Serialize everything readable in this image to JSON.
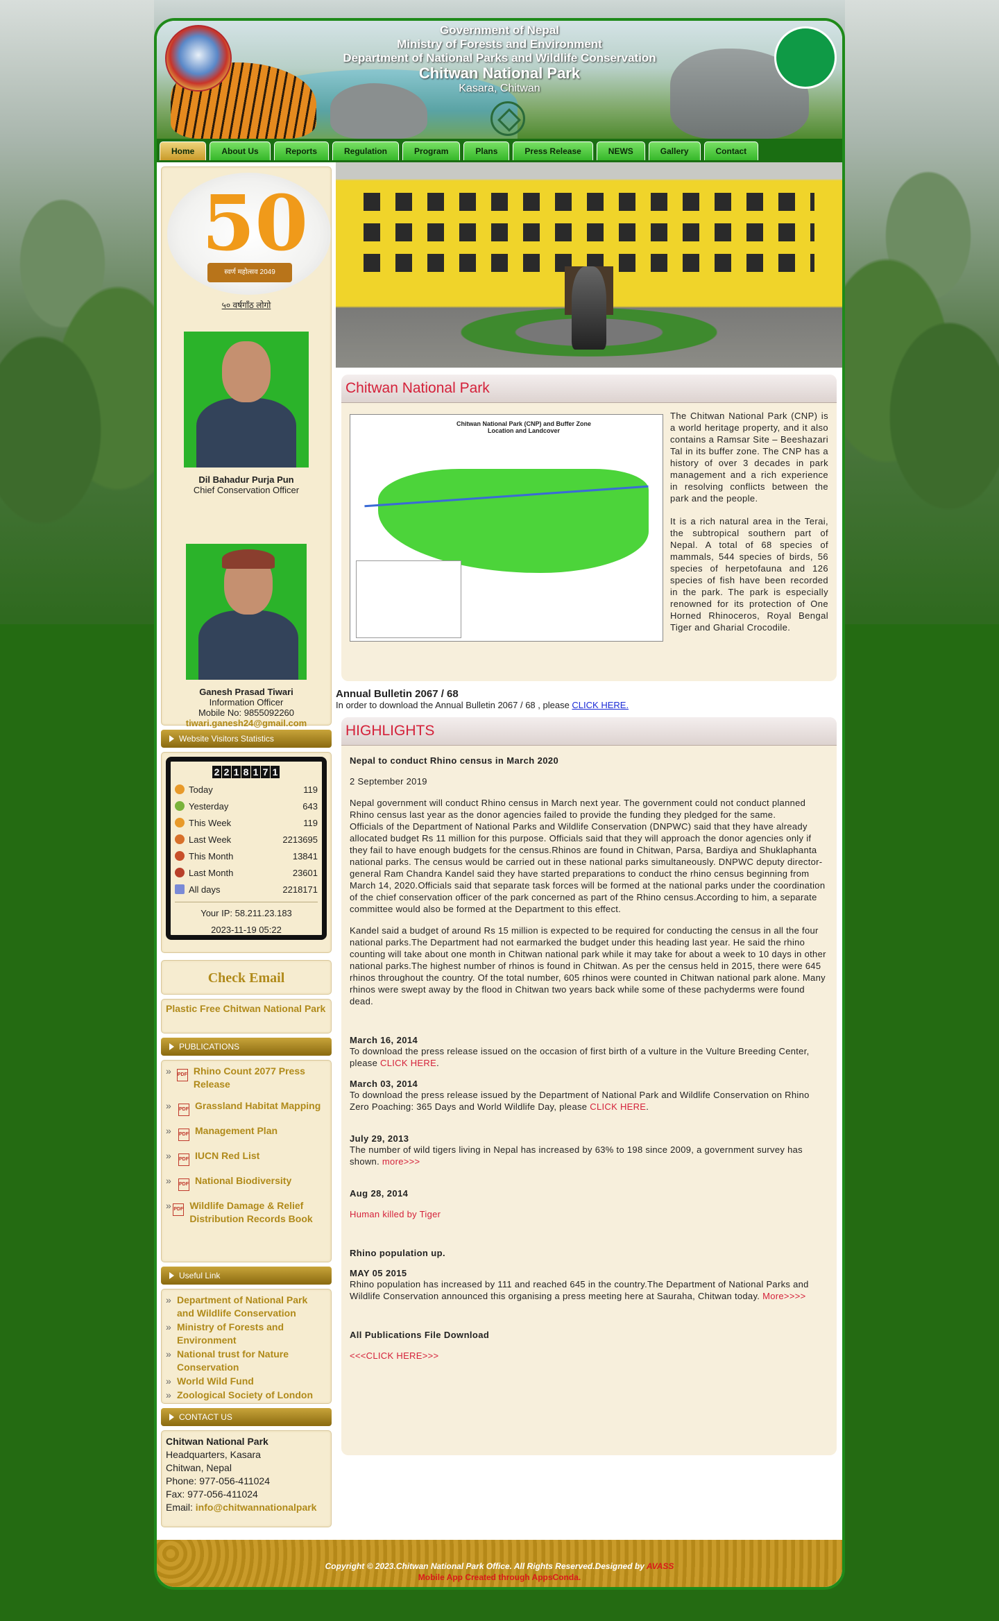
{
  "header": {
    "line1": "Government of Nepal",
    "line2": "Ministry of Forests and Environment",
    "line3": "Department of National Parks and Wildlife Conservation",
    "title": "Chitwan National Park",
    "location": "Kasara, Chitwan"
  },
  "nav": [
    "Home",
    "About Us",
    "Reports",
    "Regulation",
    "Program",
    "Plans",
    "Press Release",
    "NEWS",
    "Gallery",
    "Contact"
  ],
  "left": {
    "jubilee_link": "५० वर्षगाँठ लोगो",
    "jubilee_ribbon": "स्वर्ण महोत्सव 2049",
    "person1": {
      "name": "Dil Bahadur Purja Pun",
      "title": "Chief Conservation Officer"
    },
    "person2": {
      "name": "Ganesh Prasad Tiwari",
      "title": "Information Officer",
      "mobile": "Mobile No: 9855092260",
      "email": "tiwari.ganesh24@gmail.com"
    },
    "visitors_title": "Website Visitors Statistics",
    "counter": [
      "2",
      "2",
      "1",
      "8",
      "1",
      "7",
      "1"
    ],
    "stats": [
      {
        "label": "Today",
        "value": "119"
      },
      {
        "label": "Yesterday",
        "value": "643"
      },
      {
        "label": "This Week",
        "value": "119"
      },
      {
        "label": "Last Week",
        "value": "2213695"
      },
      {
        "label": "This Month",
        "value": "13841"
      },
      {
        "label": "Last Month",
        "value": "23601"
      },
      {
        "label": "All days",
        "value": "2218171"
      }
    ],
    "ip": "Your IP: 58.211.23.183",
    "datetime": "2023-11-19 05:22",
    "check_email": "Check Email",
    "plastic": "Plastic Free Chitwan National Park",
    "publications_title": "PUBLICATIONS",
    "publications": [
      "Rhino Count 2077 Press Release",
      "Grassland Habitat Mapping",
      "Management Plan",
      "IUCN Red List",
      "National Biodiversity",
      "Wildlife Damage & Relief Distribution Records Book"
    ],
    "useful_title": "Useful Link",
    "useful": [
      "Department of National Park and Wildlife Conservation",
      "Ministry of Forests and Environment",
      "National trust for Nature Conservation",
      "World Wild Fund",
      "Zoological Society of London"
    ],
    "contact_title": "CONTACT US",
    "contact": {
      "name": "Chitwan National Park",
      "hq": "Headquarters, Kasara",
      "city": "Chitwan, Nepal",
      "phone": "Phone: 977-056-411024",
      "fax": "Fax: 977-056-411024",
      "email_label": "Email: ",
      "email": "info@chitwannationalpark"
    }
  },
  "cnp": {
    "title": "Chitwan National Park",
    "map_title": "Chitwan National Park (CNP) and Buffer Zone",
    "map_sub": "Location and Landcover",
    "para1": "The Chitwan National Park (CNP) is a world heritage property, and it also contains a Ramsar Site – Beeshazari Tal in its buffer zone. The CNP has a history of over 3 decades in park management and a rich experience in resolving conflicts between the park and the people.",
    "para2": "It is a rich natural area in the Terai, the subtropical southern part of Nepal. A total of 68 species of mammals, 544 species of birds, 56 species of herpetofauna and 126 species of fish have been recorded in the park. The park is especially renowned for its protection of One Horned Rhinoceros, Royal Bengal Tiger and Gharial Crocodile."
  },
  "annual": {
    "title": "Annual Bulletin 2067 / 68",
    "text": "In order to download the Annual Bulletin 2067 / 68 , please ",
    "link": "CLICK HERE."
  },
  "highlights": {
    "title": "HIGHLIGHTS",
    "h1": "Nepal to conduct Rhino census in March 2020",
    "date1": "2 September 2019",
    "p1": "Nepal government will conduct Rhino census in March next year.  The government could not conduct planned Rhino census last year as the donor agencies failed to provide the funding they pledged for the same.",
    "p2": "Officials of the Department of National Parks and Wildlife Conservation (DNPWC) said that they have already allocated budget Rs 11 million for this purpose. Officials said that they will approach the donor agencies only if they fail to have enough budgets for the census.Rhinos are found in Chitwan, Parsa, Bardiya and Shuklaphanta national parks. The census would be carried out in these national parks simultaneously. DNPWC deputy director-general Ram Chandra Kandel said they have started preparations to conduct the rhino census beginning from March 14, 2020.Officials said that separate task forces will be formed at the national parks under the coordination of the chief conservation officer of the park concerned as part of the Rhino census.According to him, a separate committee would also be formed at the Department to this effect.",
    "p3": "Kandel said a budget of around Rs 15 million is expected to be required for conducting the census in all the four national parks.The Department had not earmarked the budget under this heading last year. He said the rhino counting will take about one month in Chitwan national park while it may take for about a week to 10 days in other national parks.The highest number of rhinos is found in Chitwan. As per the census held in 2015, there were 645 rhinos throughout the country. Of the total number, 605 rhinos were counted in Chitwan national park alone. Many rhinos were swept away by the flood in Chitwan two years back while some of these pachyderms were found dead.",
    "d2": "March 16, 2014",
    "t2": "To download the press release issued on the occasion of first birth of a vulture in the Vulture Breeding Center, please ",
    "l2": "CLICK HERE",
    "d3": "March 03, 2014",
    "t3": "To download the press release issued by the Department of National Park and Wildlife Conservation on Rhino Zero Poaching: 365 Days and World Wildlife Day, please ",
    "l3": "CLICK HERE",
    "d4": "July 29, 2013",
    "t4": "The number of wild tigers living in Nepal has increased by 63% to 198 since 2009, a government survey has shown. ",
    "l4": "more>>>",
    "d5": "Aug 28, 2014",
    "l5": "Human killed by Tiger",
    "h6": "Rhino population up.",
    "d6": "MAY 05 2015",
    "t6": "Rhino population has increased by 111 and reached 645 in the country.The Department of National Parks and Wildlife Conservation announced this organising a press meeting here at Sauraha, Chitwan today. ",
    "l6": "More>>>>",
    "h7": "All Publications File Download",
    "l7": "<<<CLICK HERE>>>"
  },
  "footer": {
    "copyright": "Copyright © 2023.Chitwan National Park Office. All Rights Reserved.Designed by ",
    "designer": "AVASS",
    "mobile": "Mobile App Created through AppsConda."
  }
}
